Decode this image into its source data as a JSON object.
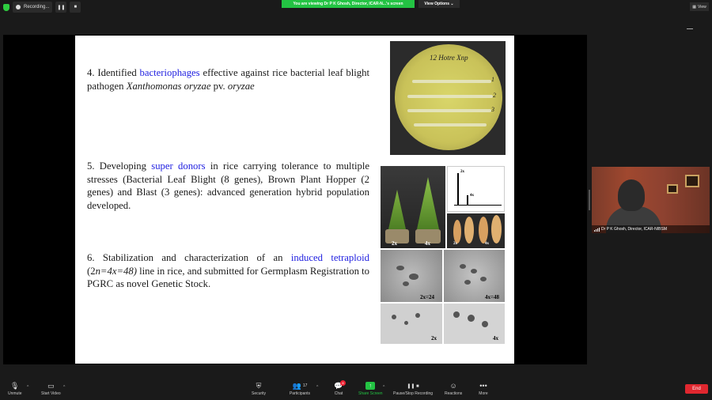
{
  "topbar": {
    "recording_label": "Recording...",
    "viewing_banner": "You are viewing Dr P K Ghosh, Director, ICAR-N...'s screen",
    "view_options": "View Options",
    "view_button": "View"
  },
  "slide": {
    "p4": {
      "prefix": "4. Identified ",
      "highlight": "bacteriophages",
      "middle": " effective against rice bacterial leaf blight pathogen ",
      "italic1": "Xanthomonas oryzae",
      "mid2": " pv. ",
      "italic2": "oryzae"
    },
    "p5": {
      "prefix": "5. Developing ",
      "highlight": "super donors",
      "rest": " in rice carrying tolerance to multiple stresses (Bacterial Leaf Blight (8 genes), Brown Plant Hopper (2 genes) and Blast (3 genes): advanced generation hybrid population developed."
    },
    "p6": {
      "prefix": "6. Stabilization and characterization of an ",
      "highlight": "induced tetraploid",
      "open": " (2",
      "italic": "n=4x=48)",
      "rest": " line in rice, and submitted for Germplasm Registration to PGRC as novel Genetic Stock."
    },
    "petri_labels": [
      "12 Hotre Xnp",
      "1",
      "2",
      "3"
    ],
    "grid_labels": {
      "plant_2x": "2x",
      "plant_4x": "4x",
      "flow_2x": "2x",
      "flow_4x": "4x",
      "seed_2x": "2x",
      "seed_4x": "4x",
      "chrom_2x": "2x=24",
      "chrom_4x": "4x=48",
      "pollen_2x": "2x",
      "pollen_4x": "4x"
    }
  },
  "video": {
    "name": "Dr P K Ghosh, Director, ICAR-NIBSM"
  },
  "toolbar": {
    "unmute": "Unmute",
    "start_video": "Start Video",
    "security": "Security",
    "participants": "Participants",
    "participants_count": "17",
    "chat": "Chat",
    "chat_badge": "8",
    "share_screen": "Share Screen",
    "pause_recording": "Pause/Stop Recording",
    "reactions": "Reactions",
    "more": "More",
    "end": "End"
  },
  "colors": {
    "highlight": "#1f1fe0",
    "share_green": "#23c343",
    "end_red": "#e0272f"
  }
}
